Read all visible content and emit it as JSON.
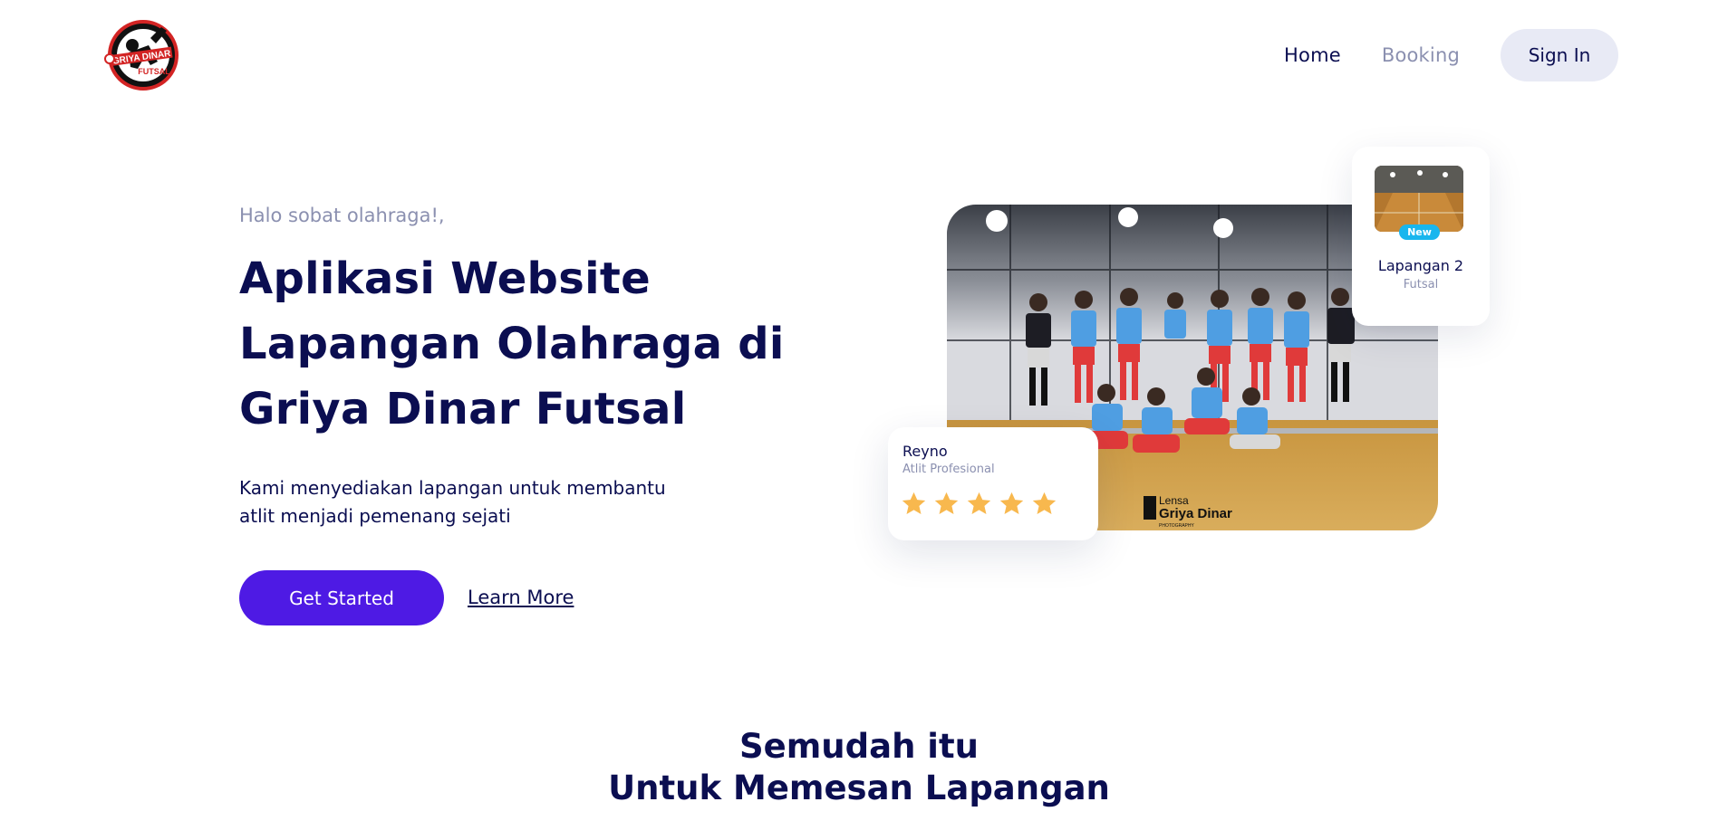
{
  "logo": {
    "text_top": "GRIYA DINAR",
    "text_bottom": "FUTSAL"
  },
  "nav": {
    "home": "Home",
    "booking": "Booking",
    "signin": "Sign In"
  },
  "hero": {
    "greeting": "Halo sobat olahraga!,",
    "headline_part1": "Aplikasi Website ",
    "headline_highlight": "Lapangan Olahraga",
    "headline_part2": " di Griya Dinar Futsal",
    "subtext_line1": "Kami menyediakan lapangan untuk membantu",
    "subtext_line2": "atlit menjadi pemenang sejati",
    "cta_primary": "Get Started",
    "cta_secondary": "Learn More"
  },
  "photo_watermark": {
    "line1": "Lensa",
    "line2": "Griya Dinar",
    "line3": "PHOTOGRAPHY"
  },
  "court_card": {
    "badge": "New",
    "name": "Lapangan 2",
    "type": "Futsal"
  },
  "review_card": {
    "name": "Reyno",
    "role": "Atlit Profesional",
    "rating": 5
  },
  "section": {
    "title_line1": "Semudah itu",
    "title_line2": "Untuk Memesan Lapangan"
  },
  "colors": {
    "navy": "#0b0e51",
    "muted": "#8b90b0",
    "primary": "#4e1ae4",
    "highlight": "#19b6ee",
    "star": "#f8b84e",
    "signin_bg": "#e8eaf5"
  }
}
